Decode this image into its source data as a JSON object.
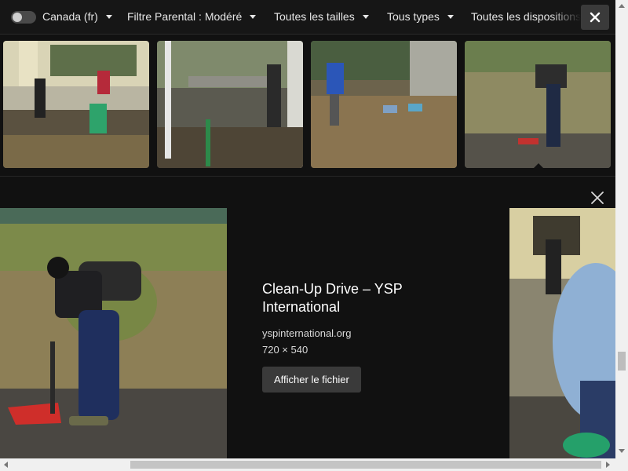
{
  "filters": {
    "safe_toggle": "off",
    "items": [
      {
        "label": "Canada (fr)"
      },
      {
        "label": "Filtre Parental : Modéré"
      },
      {
        "label": "Toutes les tailles"
      },
      {
        "label": "Tous types"
      },
      {
        "label": "Toutes les dispositions"
      }
    ],
    "close_icon": "close-icon"
  },
  "thumbnails": [
    {
      "name": "thumb-1",
      "icon": "photo"
    },
    {
      "name": "thumb-2",
      "icon": "photo"
    },
    {
      "name": "thumb-3",
      "icon": "photo"
    },
    {
      "name": "thumb-4",
      "icon": "photo",
      "selected": true
    }
  ],
  "preview": {
    "title": "Clean-Up Drive – YSP International",
    "site": "yspinternational.org",
    "dimensions": "720 × 540",
    "view_file_label": "Afficher le fichier",
    "close_icon": "close-icon"
  },
  "colors": {
    "background": "#111111",
    "filterbar": "#161616",
    "button": "#3a3a3a"
  }
}
